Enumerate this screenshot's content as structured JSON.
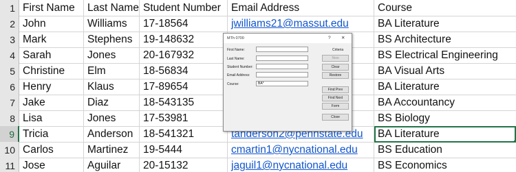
{
  "sheet": {
    "header": {
      "row": "1",
      "first_name": "First Name",
      "last_name": "Last Name",
      "student_number": "Student Number",
      "email": "Email Address",
      "course": "Course"
    },
    "rows": [
      {
        "row": "2",
        "first_name": "John",
        "last_name": "Williams",
        "student_number": "17-18564",
        "email": "jwilliams21@massut.edu",
        "course": "BA Literature"
      },
      {
        "row": "3",
        "first_name": "Mark",
        "last_name": "Stephens",
        "student_number": "19-148632",
        "email": "",
        "course": "BS Architecture"
      },
      {
        "row": "4",
        "first_name": "Sarah",
        "last_name": "Jones",
        "student_number": "20-167932",
        "email": "",
        "course": "BS Electrical Engineering"
      },
      {
        "row": "5",
        "first_name": "Christine",
        "last_name": "Elm",
        "student_number": "18-56834",
        "email": "",
        "course": "BA Visual Arts"
      },
      {
        "row": "6",
        "first_name": "Henry",
        "last_name": "Klaus",
        "student_number": "17-89654",
        "email": "",
        "course": "BA Literature"
      },
      {
        "row": "7",
        "first_name": "Jake",
        "last_name": "Diaz",
        "student_number": "18-543135",
        "email": "",
        "course": "BA Accountancy"
      },
      {
        "row": "8",
        "first_name": "Lisa",
        "last_name": "Jones",
        "student_number": "17-53981",
        "email": "",
        "course": "BS Biology"
      },
      {
        "row": "9",
        "first_name": "Tricia",
        "last_name": "Anderson",
        "student_number": "18-541321",
        "email": "tanderson2@pennstate.edu",
        "course": "BA Literature"
      },
      {
        "row": "10",
        "first_name": "Carlos",
        "last_name": "Martinez",
        "student_number": "19-5444",
        "email": "cmartin1@nycnational.edu",
        "course": "BS Education"
      },
      {
        "row": "11",
        "first_name": "Jose",
        "last_name": "Aguilar",
        "student_number": "20-15132",
        "email": "jaguil1@nycnational.edu",
        "course": "BS Economics"
      }
    ],
    "selected_row": "9"
  },
  "dialog": {
    "title": "MTh 0700",
    "help": "?",
    "close_glyph": "✕",
    "counter": "",
    "criteria_label": "Criteria",
    "fields": [
      {
        "label": "First Name:",
        "value": ""
      },
      {
        "label": "Last Name:",
        "value": ""
      },
      {
        "label": "Student Number:",
        "value": ""
      },
      {
        "label": "Email Address:",
        "value": ""
      },
      {
        "label": "Course:",
        "value": "BA*"
      }
    ],
    "buttons": {
      "new": "New",
      "clear": "Clear",
      "restore": "Restore",
      "find_prev": "Find Prev",
      "find_next": "Find Next",
      "form": "Form",
      "close": "Close"
    }
  },
  "colors": {
    "link": "#1155cc",
    "selection": "#217346",
    "row_header": "#e6e6e6",
    "dialog_bg": "#f0f0f0"
  }
}
